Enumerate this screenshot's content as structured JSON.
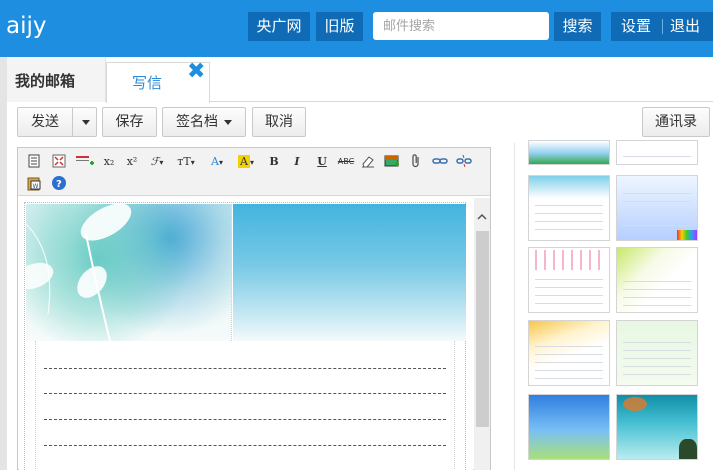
{
  "app": {
    "title": "aijy"
  },
  "topnav": {
    "cctv": "央广网",
    "old_version": "旧版",
    "search_placeholder": "邮件搜索",
    "search_button": "搜索",
    "settings": "设置",
    "logout": "退出"
  },
  "tabs": {
    "mailbox": "我的邮箱",
    "compose": "写信",
    "close_glyph": "✖"
  },
  "toolbar": {
    "send": "发送",
    "save": "保存",
    "signature": "签名档",
    "cancel": "取消",
    "contacts": "通讯录"
  },
  "editor_toolbar": {
    "icons": [
      "source-icon",
      "fullscreen-icon",
      "insert-row-icon",
      "subscript-icon",
      "superscript-icon",
      "font-family-icon",
      "font-size-icon",
      "font-color-icon",
      "highlight-color-icon",
      "bold-icon",
      "italic-icon",
      "underline-icon",
      "strikethrough-icon",
      "eraser-icon",
      "insert-image-icon",
      "attachment-icon",
      "link-icon",
      "unlink-icon",
      "paste-word-icon",
      "help-icon"
    ],
    "subscript": "x₂",
    "superscript": "x²",
    "font_family": "ℱ",
    "font_size": "тT",
    "font_color": "A",
    "highlight": "A",
    "bold": "B",
    "italic": "I",
    "underline": "U",
    "strikethrough": "ABC"
  },
  "stationery_panel": {
    "thumbnails": [
      "stationery-thumbnail"
    ]
  },
  "colors": {
    "topbar": "#1e8fe0",
    "topbutton": "#0f6bb5",
    "accent_text": "#2a8ad8"
  }
}
